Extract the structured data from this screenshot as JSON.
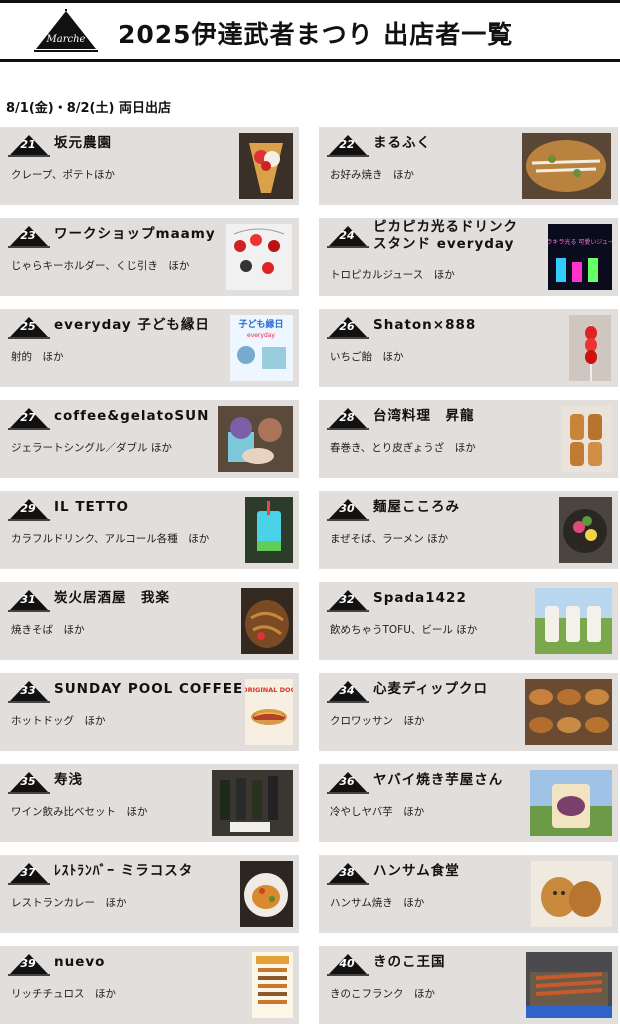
{
  "header": {
    "logo_text": "Marche",
    "title": "2025伊達武者まつり 出店者一覧"
  },
  "subheading": "8/1(金)・8/2(土) 両日出店",
  "vendors": [
    {
      "num": "21",
      "name": "坂元農園",
      "desc": "クレープ、ポテトほか"
    },
    {
      "num": "22",
      "name": "まるふく",
      "desc": "お好み焼き　ほか"
    },
    {
      "num": "23",
      "name": "ワークショップmaamy",
      "desc": "じゃらキーホルダー、くじ引き　ほか"
    },
    {
      "num": "24",
      "name_line1": "ピカピカ光るドリンク",
      "name_line2": "スタンド everyday",
      "desc": "トロピカルジュース　ほか"
    },
    {
      "num": "25",
      "name": "everyday 子ども縁日",
      "desc": "射的　ほか"
    },
    {
      "num": "26",
      "name": "Shaton×888",
      "desc": "いちご飴　ほか"
    },
    {
      "num": "27",
      "name": "coffee&gelatoSUN",
      "desc": "ジェラートシングル／ダブル ほか"
    },
    {
      "num": "28",
      "name": "台湾料理　昇龍",
      "desc": "春巻き、とり皮ぎょうざ　ほか"
    },
    {
      "num": "29",
      "name": "IL TETTO",
      "desc": "カラフルドリンク、アルコール各種　ほか"
    },
    {
      "num": "30",
      "name": "麺屋こころみ",
      "desc": "まぜそば、ラーメン ほか"
    },
    {
      "num": "31",
      "name": "炭火居酒屋　我楽",
      "desc": "焼きそば　ほか"
    },
    {
      "num": "32",
      "name": "Spada1422",
      "desc": "飲めちゃうTOFU、ビール ほか"
    },
    {
      "num": "33",
      "name": "SUNDAY POOL COFFEE",
      "desc": "ホットドッグ　ほか"
    },
    {
      "num": "34",
      "name": "心麦ディップクロ",
      "desc": "クロワッサン　ほか"
    },
    {
      "num": "35",
      "name": "寿浅",
      "desc": "ワイン飲み比べセット　ほか"
    },
    {
      "num": "36",
      "name": "ヤバイ焼き芋屋さん",
      "desc": "冷やしヤバ芋　ほか"
    },
    {
      "num": "37",
      "name": "ﾚｽﾄﾗﾝﾊﾞｰ ミラコスタ",
      "desc": "レストランカレー　ほか"
    },
    {
      "num": "38",
      "name": "ハンサム食堂",
      "desc": "ハンサム焼き　ほか"
    },
    {
      "num": "39",
      "name": "nuevo",
      "desc": "リッチチュロス　ほか"
    },
    {
      "num": "40",
      "name": "きのこ王国",
      "desc": "きのこフランク　ほか"
    }
  ],
  "photo_texts": {
    "v24": "キラキラ光る 可愛いジュース",
    "v25_title": "子ども縁日",
    "v25_sub": "everyday",
    "v33": "ORIGINAL DOG"
  },
  "colors": {
    "card_bg": "#e2dedb",
    "ink": "#111111"
  }
}
